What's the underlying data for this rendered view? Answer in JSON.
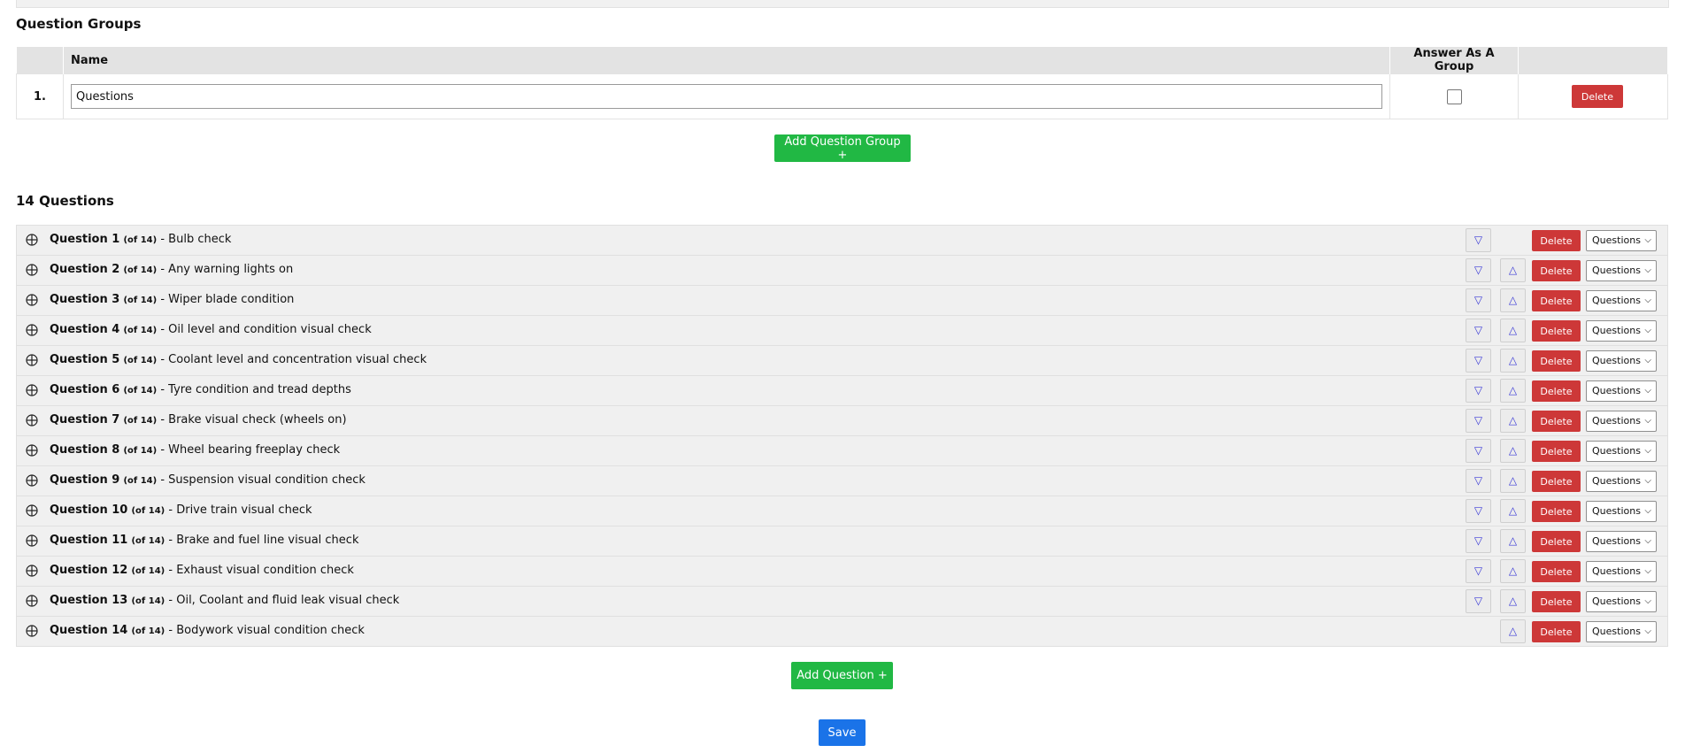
{
  "groups": {
    "title": "Question Groups",
    "headers": {
      "name": "Name",
      "answer_as_group": "Answer As A Group"
    },
    "rows": [
      {
        "index": "1.",
        "name": "Questions",
        "answer_as_group": false,
        "delete_label": "Delete"
      }
    ],
    "add_label": "Add Question Group +"
  },
  "questions": {
    "title": "14 Questions",
    "delete_label": "Delete",
    "group_select_value": "Questions",
    "items": [
      {
        "label": "Question 1",
        "of": "(of 14)",
        "text": "Bulb check"
      },
      {
        "label": "Question 2",
        "of": "(of 14)",
        "text": "Any warning lights on"
      },
      {
        "label": "Question 3",
        "of": "(of 14)",
        "text": "Wiper blade condition"
      },
      {
        "label": "Question 4",
        "of": "(of 14)",
        "text": "Oil level and condition visual check"
      },
      {
        "label": "Question 5",
        "of": "(of 14)",
        "text": "Coolant level and concentration visual check"
      },
      {
        "label": "Question 6",
        "of": "(of 14)",
        "text": "Tyre condition and tread depths"
      },
      {
        "label": "Question 7",
        "of": "(of 14)",
        "text": "Brake visual check (wheels on)"
      },
      {
        "label": "Question 8",
        "of": "(of 14)",
        "text": "Wheel bearing freeplay check"
      },
      {
        "label": "Question 9",
        "of": "(of 14)",
        "text": "Suspension visual condition check"
      },
      {
        "label": "Question 10",
        "of": "(of 14)",
        "text": "Drive train visual check"
      },
      {
        "label": "Question 11",
        "of": "(of 14)",
        "text": "Brake and fuel line visual check"
      },
      {
        "label": "Question 12",
        "of": "(of 14)",
        "text": "Exhaust visual condition check"
      },
      {
        "label": "Question 13",
        "of": "(of 14)",
        "text": "Oil, Coolant and fluid leak visual check"
      },
      {
        "label": "Question 14",
        "of": "(of 14)",
        "text": "Bodywork visual condition check"
      }
    ],
    "add_label": "Add Question +"
  },
  "save_label": "Save",
  "icons": {
    "drag": "move-crosshair-icon",
    "down": "triangle-down-icon",
    "up": "triangle-up-icon"
  },
  "colors": {
    "delete": "#cd3838",
    "add": "#21b844",
    "save": "#1a73e8"
  }
}
